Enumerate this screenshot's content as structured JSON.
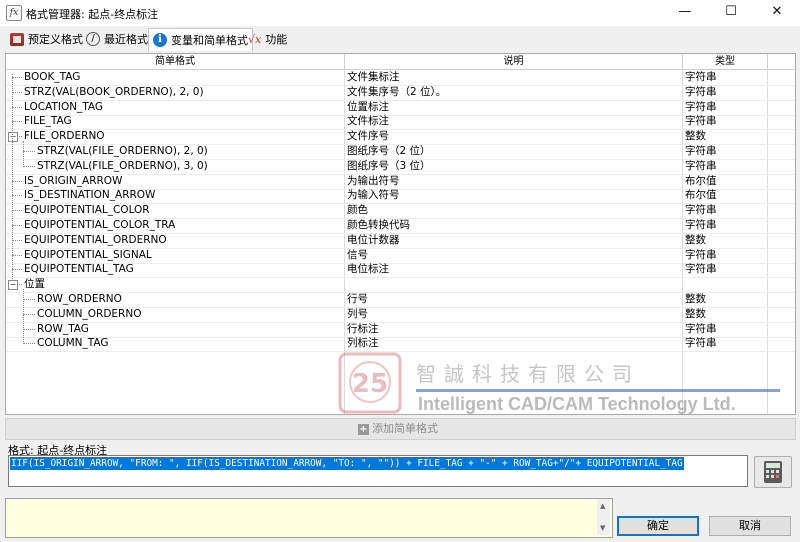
{
  "window": {
    "title": "格式管理器: 起点-终点标注",
    "app_icon_glyph": "fx",
    "minimize_glyph": "—",
    "maximize_glyph": "☐",
    "close_glyph": "✕"
  },
  "tabs": [
    {
      "label": "预定义格式",
      "icon": "predefined-format-icon",
      "active": false
    },
    {
      "label": "最近格式",
      "icon": "recent-clock-icon",
      "active": false
    },
    {
      "label": "变量和简单格式",
      "icon": "info-icon",
      "active": true
    },
    {
      "label": "功能",
      "icon": "function-icon",
      "active": false
    }
  ],
  "table": {
    "headers": {
      "format": "简单格式",
      "description": "说明",
      "type": "类型"
    },
    "rows": [
      {
        "format": "BOOK_TAG",
        "description": "文件集标注",
        "type": "字符串",
        "level": 0
      },
      {
        "format": "STRZ(VAL(BOOK_ORDERNO), 2, 0)",
        "description": "文件集序号（2 位）。",
        "type": "字符串",
        "level": 0
      },
      {
        "format": "LOCATION_TAG",
        "description": "位置标注",
        "type": "字符串",
        "level": 0
      },
      {
        "format": "FILE_TAG",
        "description": "文件标注",
        "type": "字符串",
        "level": 0
      },
      {
        "format": "FILE_ORDERNO",
        "description": "文件序号",
        "type": "整数",
        "level": 0,
        "expander": "⊟"
      },
      {
        "format": "STRZ(VAL(FILE_ORDERNO), 2, 0)",
        "description": "图纸序号（2 位）",
        "type": "字符串",
        "level": 1
      },
      {
        "format": "STRZ(VAL(FILE_ORDERNO), 3, 0)",
        "description": "图纸序号（3 位）",
        "type": "字符串",
        "level": 1
      },
      {
        "format": "IS_ORIGIN_ARROW",
        "description": "为输出符号",
        "type": "布尔值",
        "level": 0
      },
      {
        "format": "IS_DESTINATION_ARROW",
        "description": "为输入符号",
        "type": "布尔值",
        "level": 0
      },
      {
        "format": "EQUIPOTENTIAL_COLOR",
        "description": "颜色",
        "type": "字符串",
        "level": 0
      },
      {
        "format": "EQUIPOTENTIAL_COLOR_TRA",
        "description": "颜色转换代码",
        "type": "字符串",
        "level": 0
      },
      {
        "format": "EQUIPOTENTIAL_ORDERNO",
        "description": "电位计数器",
        "type": "整数",
        "level": 0
      },
      {
        "format": "EQUIPOTENTIAL_SIGNAL",
        "description": "信号",
        "type": "字符串",
        "level": 0
      },
      {
        "format": "EQUIPOTENTIAL_TAG",
        "description": "电位标注",
        "type": "字符串",
        "level": 0
      },
      {
        "format": "位置",
        "description": "",
        "type": "",
        "level": 0,
        "expander": "⊟"
      },
      {
        "format": "ROW_ORDERNO",
        "description": "行号",
        "type": "整数",
        "level": 1
      },
      {
        "format": "COLUMN_ORDERNO",
        "description": "列号",
        "type": "整数",
        "level": 1
      },
      {
        "format": "ROW_TAG",
        "description": "行标注",
        "type": "字符串",
        "level": 1
      },
      {
        "format": "COLUMN_TAG",
        "description": "列标注",
        "type": "字符串",
        "level": 1
      }
    ]
  },
  "watermark": {
    "logo_text": "25",
    "chinese": "智誠科技有限公司",
    "english": "Intelligent CAD/CAM Technology Ltd."
  },
  "add_button": {
    "label": "添加简单格式",
    "icon": "plus-icon"
  },
  "format": {
    "label": "格式: 起点-终点标注",
    "value": "IIF(IS_ORIGIN_ARROW, \"FROM: \", IIF(IS_DESTINATION_ARROW, \"TO:  \", \"\")) + FILE_TAG + \"-\" + ROW_TAG+\"/\"+ EQUIPOTENTIAL_TAG"
  },
  "buttons": {
    "ok": "确定",
    "cancel": "取消"
  },
  "colors": {
    "selection": "#0078d7",
    "notes_bg": "#ffffe1",
    "accent_border": "#0078d7"
  }
}
